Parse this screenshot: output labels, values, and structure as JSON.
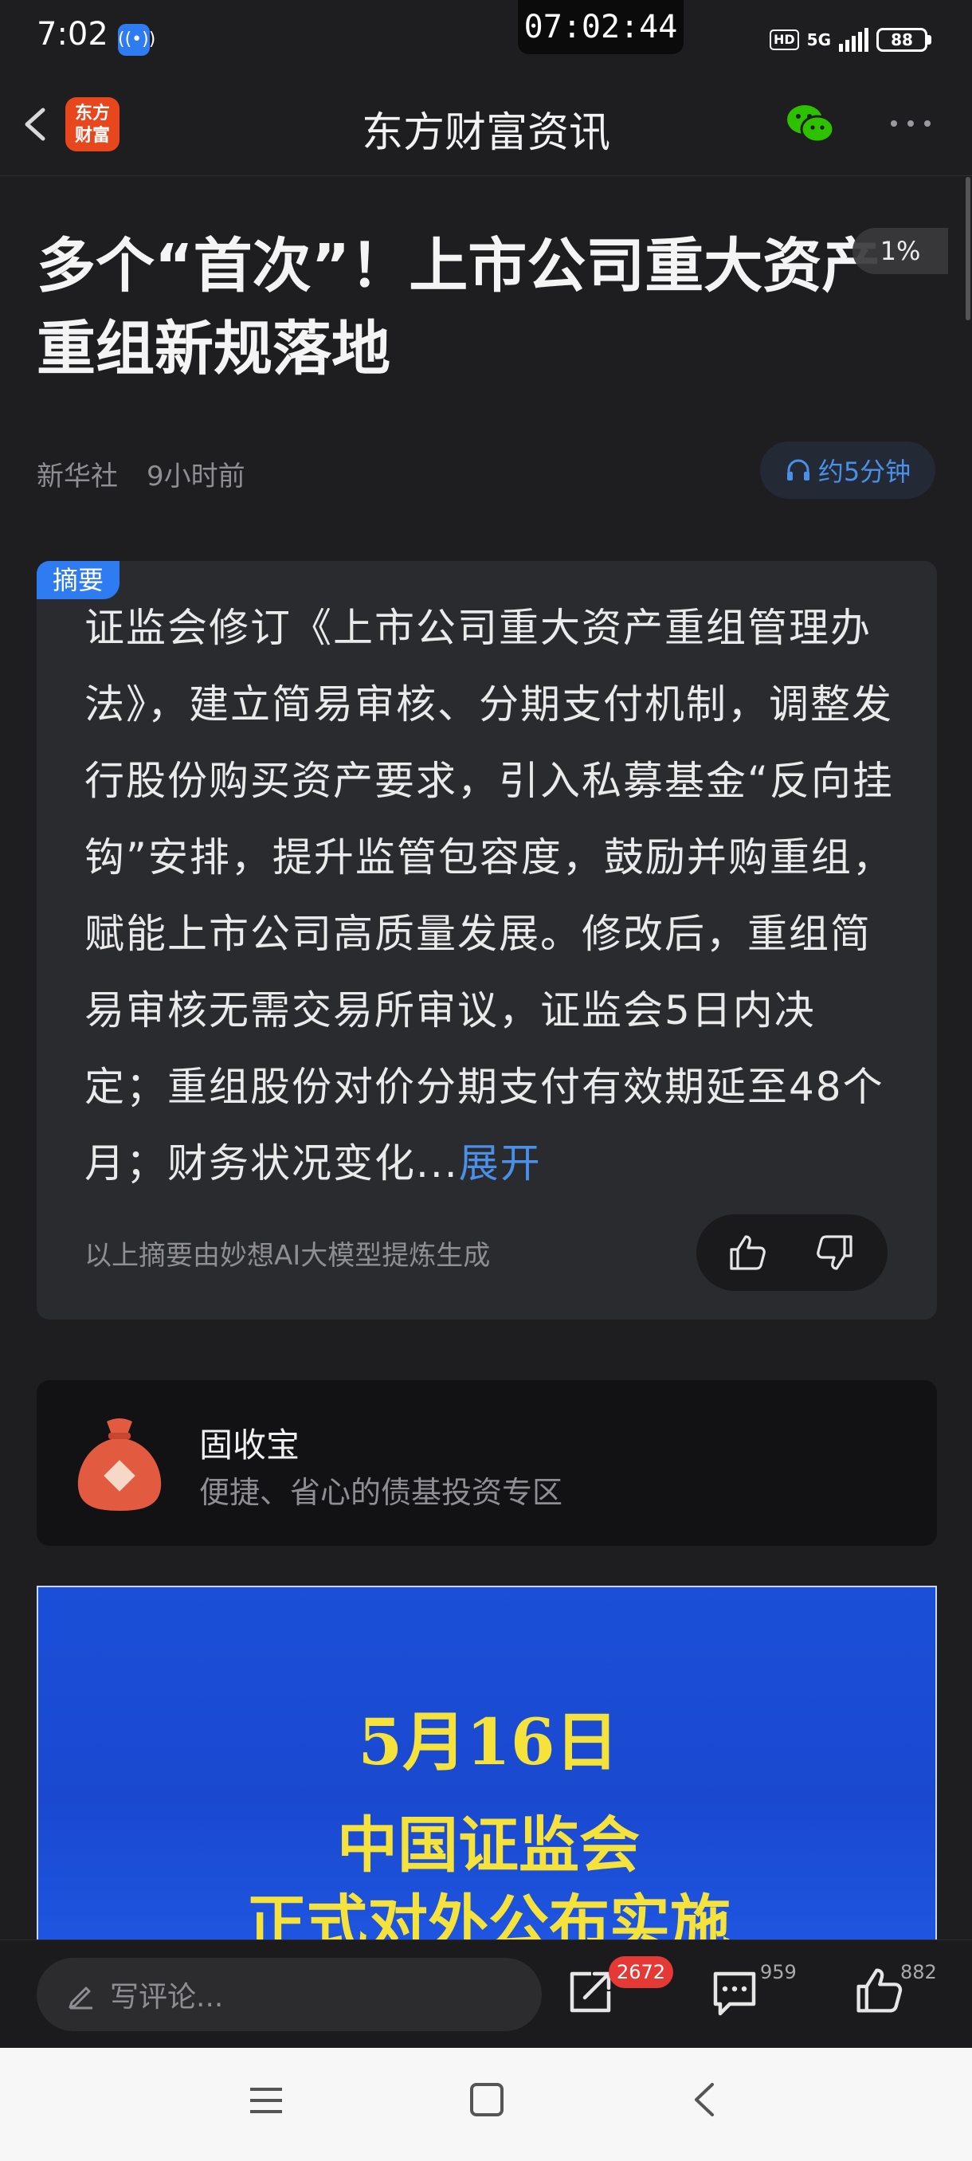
{
  "status_bar": {
    "time": "7:02",
    "clock": "07:02:44",
    "hd": "HD",
    "network": "5G",
    "battery": "88"
  },
  "header": {
    "logo_line1": "东方",
    "logo_line2": "财富",
    "title": "东方财富资讯"
  },
  "article": {
    "title": "多个“首次”！上市公司重大资产重组新规落地",
    "read_progress": "1%",
    "source": "新华社",
    "time_ago": "9小时前",
    "listen_label": "约5分钟"
  },
  "summary": {
    "tag": "摘要",
    "text": "证监会修订《上市公司重大资产重组管理办法》，建立简易审核、分期支付机制，调整发行股份购买资产要求，引入私募基金“反向挂钩”安排，提升监管包容度，鼓励并购重组，赋能上市公司高质量发展。修改后，重组简易审核无需交易所审议，证监会5日内决定；重组股份对价分期支付有效期延至48个月；财务状况变化",
    "ellipsis": "...",
    "expand_label": "展开",
    "ai_note": "以上摘要由妙想AI大模型提炼生成"
  },
  "promo": {
    "title": "固收宝",
    "subtitle": "便捷、省心的债基投资专区"
  },
  "image": {
    "line1": "5月16日",
    "line2": "中国证监会",
    "line3": "正式对外公布实施"
  },
  "action_bar": {
    "comment_placeholder": "写评论...",
    "share_badge": "2672",
    "comment_count": "959",
    "like_count": "882"
  },
  "colors": {
    "background": "#1e1e20",
    "accent": "#2f7bf1",
    "link": "#4a8fe8",
    "brand": "#e8461d",
    "badge": "#e53935"
  }
}
